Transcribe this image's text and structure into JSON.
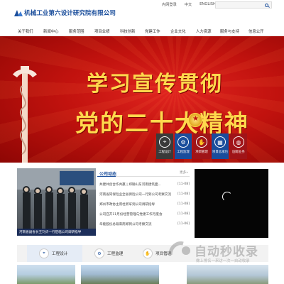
{
  "header": {
    "logo_text": "机械工业第六设计研究院有限公司",
    "top_links": [
      "内网登录",
      "中文",
      "ENGLISH"
    ]
  },
  "nav": {
    "items": [
      "关于我们",
      "新闻中心",
      "服务范围",
      "项目业绩",
      "科技创新",
      "党建工作",
      "企业文化",
      "人力资源",
      "服务与支持",
      "信息公开"
    ]
  },
  "banner": {
    "line1": "学习宣传贯彻",
    "line2": "党的二十大精神",
    "slide_count": 5,
    "active_slide": 1
  },
  "quick_links": [
    {
      "label": "工程设计",
      "icon": "compass-icon"
    },
    {
      "label": "工程监理",
      "icon": "gear-icon"
    },
    {
      "label": "项目管理",
      "icon": "hand-icon"
    },
    {
      "label": "项目总承包",
      "icon": "building-icon"
    },
    {
      "label": "国际业务",
      "icon": "globe-icon"
    }
  ],
  "photo": {
    "caption": "河南省副省长王刘贞一行莅临公司调研指导"
  },
  "news": {
    "title": "公司动态",
    "more": "更多»",
    "items": [
      {
        "text": "共建共创合作共赢 | 郑钢山东河南建筑面...",
        "date": "[11-08]"
      },
      {
        "text": "河南省同保险业全省保险公司一行到公司考察交流",
        "date": "[11-08]"
      },
      {
        "text": "郑州市政协主席杜新军到公司调研指导",
        "date": "[11-08]"
      },
      {
        "text": "公司召开11月份经营管理与党建工作月度会",
        "date": "[11-08]"
      },
      {
        "text": "华能股份总裁来南郑到公司考察交流",
        "date": "[11-06]"
      }
    ]
  },
  "tabs": [
    {
      "label": "工程设计",
      "icon": "compass-icon"
    },
    {
      "label": "工程监理",
      "icon": "gear-icon"
    },
    {
      "label": "项目管理",
      "icon": "hand-icon"
    }
  ],
  "watermark": {
    "text": "自动秒收录",
    "sub": "做上排名一来访一次一自动收录"
  },
  "colors": {
    "brand_blue": "#1c4f9c",
    "banner_red": "#c1120e",
    "banner_gold": "#ffd84d"
  }
}
